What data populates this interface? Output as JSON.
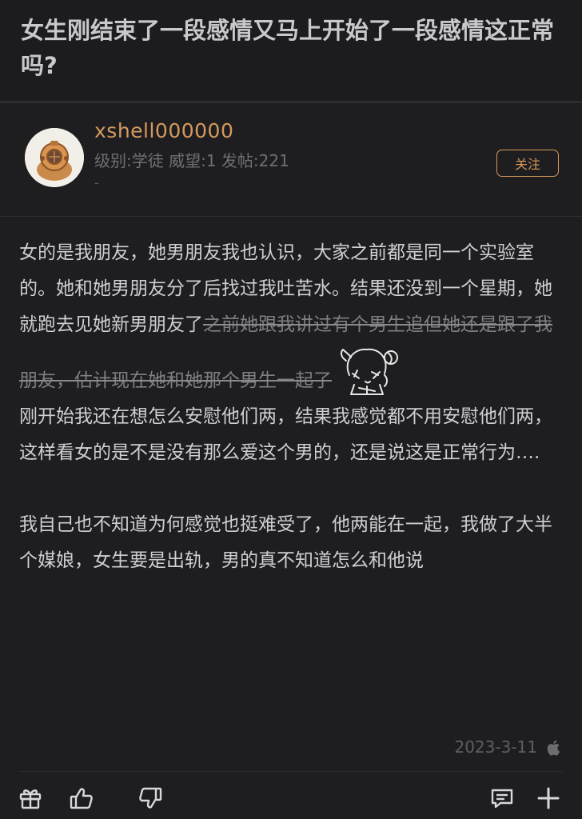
{
  "post": {
    "title": "女生刚结束了一段感情又马上开始了一段感情这正常吗?"
  },
  "author": {
    "username": "xshell000000",
    "meta": "级别:学徒 威望:1 发帖:221",
    "signature": "-",
    "follow_label": "关注",
    "avatar_icon": "diving-helmet-avatar"
  },
  "content": {
    "p1_normal": "女的是我朋友，她男朋友我也认识，大家之前都是同一个实验室的。她和她男朋友分了后找过我吐苦水。结果还没到一个星期，她就跑去见她新男朋友了",
    "p1_strike": "之前她跟我讲过有个男生追但她还是跟了我朋友，估计现在她和她那个男生一起了",
    "sticker_icon": "anime-girl-sticker-icon",
    "p2": "刚开始我还在想怎么安慰他们两，结果我感觉都不用安慰他们两，这样看女的是不是没有那么爱这个男的，还是说这是正常行为….",
    "p3": "我自己也不知道为何感觉也挺难受了，他两能在一起，我做了大半个媒娘，女生要是出轨，男的真不知道怎么和他说"
  },
  "footer": {
    "date": "2023-3-11",
    "device_icon": "apple-icon"
  },
  "toolbar": {
    "icons": [
      "gift-icon",
      "thumbs-up-icon",
      "thumbs-down-icon",
      "comment-icon",
      "plus-icon"
    ]
  },
  "colors": {
    "background": "#1e1e21",
    "accent": "#d99a57",
    "text": "#cfcfd1",
    "muted": "#6f6f73"
  }
}
